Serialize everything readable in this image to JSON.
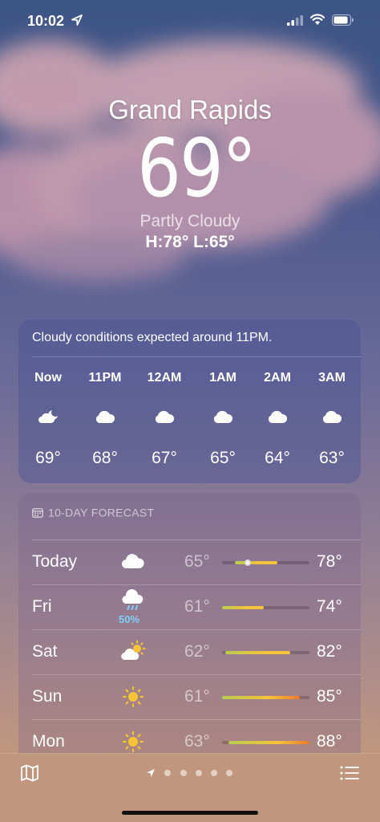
{
  "status_bar": {
    "time": "10:02",
    "icons": [
      "location-arrow-icon",
      "cellular-signal-icon",
      "wifi-icon",
      "battery-icon"
    ]
  },
  "current": {
    "city": "Grand Rapids",
    "temperature": "69°",
    "condition": "Partly Cloudy",
    "high_low": "H:78°  L:65°"
  },
  "hourly": {
    "message": "Cloudy conditions expected around 11PM.",
    "hours": [
      {
        "label": "Now",
        "icon": "partly-cloudy-night-icon",
        "temp": "69°"
      },
      {
        "label": "11PM",
        "icon": "cloud-icon",
        "temp": "68°"
      },
      {
        "label": "12AM",
        "icon": "cloud-icon",
        "temp": "67°"
      },
      {
        "label": "1AM",
        "icon": "cloud-icon",
        "temp": "65°"
      },
      {
        "label": "2AM",
        "icon": "cloud-icon",
        "temp": "64°"
      },
      {
        "label": "3AM",
        "icon": "cloud-icon",
        "temp": "63°"
      }
    ]
  },
  "forecast": {
    "header": "10-DAY FORECAST",
    "header_icon": "calendar-icon",
    "range_min": 61,
    "range_max": 88,
    "days": [
      {
        "day": "Today",
        "icon": "cloud-icon",
        "precip": "",
        "low": "65°",
        "high": "78°",
        "low_value": 65,
        "high_value": 78,
        "current_value": 69
      },
      {
        "day": "Fri",
        "icon": "cloud-rain-icon",
        "precip": "50%",
        "low": "61°",
        "high": "74°",
        "low_value": 61,
        "high_value": 74
      },
      {
        "day": "Sat",
        "icon": "partly-cloudy-day-icon",
        "precip": "",
        "low": "62°",
        "high": "82°",
        "low_value": 62,
        "high_value": 82
      },
      {
        "day": "Sun",
        "icon": "sun-icon",
        "precip": "",
        "low": "61°",
        "high": "85°",
        "low_value": 61,
        "high_value": 85
      },
      {
        "day": "Mon",
        "icon": "sun-icon",
        "precip": "",
        "low": "63°",
        "high": "88°",
        "low_value": 63,
        "high_value": 88
      }
    ]
  },
  "bottom_bar": {
    "left_icon": "map-icon",
    "right_icon": "list-icon",
    "page_count": 5
  },
  "colors": {
    "bar_cool": "#b8cc50",
    "bar_warm": "#f5c43a",
    "bar_hot": "#f07a2e",
    "precip": "#7dd1ff"
  }
}
